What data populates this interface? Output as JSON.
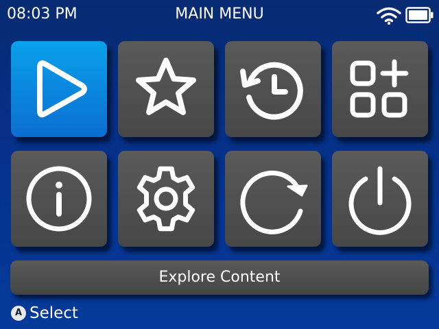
{
  "status_bar": {
    "time": "08:03 PM",
    "title": "MAIN MENU",
    "icons": [
      "wifi-icon",
      "battery-icon"
    ]
  },
  "menu": {
    "tiles": [
      {
        "icon": "play-icon",
        "selected": true
      },
      {
        "icon": "star-icon",
        "selected": false
      },
      {
        "icon": "history-icon",
        "selected": false
      },
      {
        "icon": "apps-add-icon",
        "selected": false
      },
      {
        "icon": "info-icon",
        "selected": false
      },
      {
        "icon": "gear-icon",
        "selected": false
      },
      {
        "icon": "refresh-icon",
        "selected": false
      },
      {
        "icon": "power-icon",
        "selected": false
      }
    ],
    "explore_label": "Explore Content"
  },
  "footer": {
    "button_glyph": "A",
    "hint_label": "Select"
  },
  "colors": {
    "background": "#05328f",
    "tile": "#505050",
    "tile_selected": "#0a8ee0",
    "icon_stroke": "#ffffff"
  }
}
